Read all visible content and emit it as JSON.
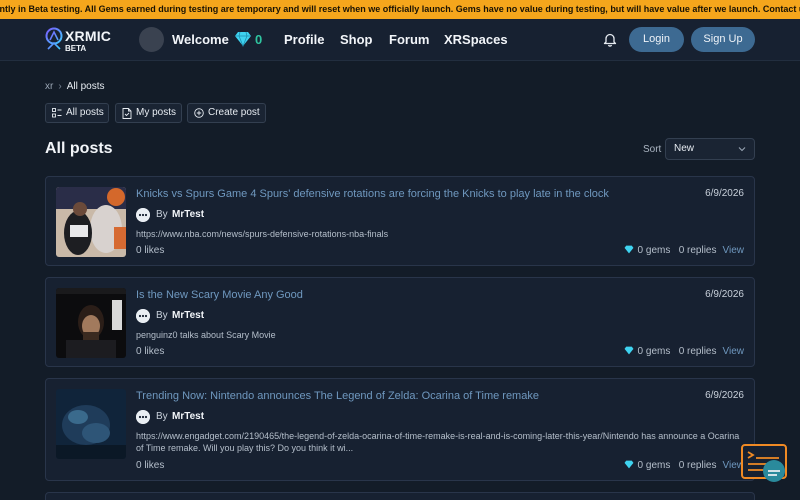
{
  "banner": {
    "text": "rently in Beta testing. All Gems earned during testing are temporary and will reset when we officially launch. Gems have no value during testing, but will have value after we launch. Contact us for any que"
  },
  "header": {
    "logo_text": "XRMIC",
    "logo_sub": "BETA",
    "welcome": "Welcome",
    "gem_count": "0",
    "nav": [
      "Profile",
      "Shop",
      "Forum",
      "XRSpaces"
    ],
    "login_label": "Login",
    "signup_label": "Sign Up"
  },
  "breadcrumb": {
    "root": "xr",
    "current": "All posts"
  },
  "tabs": [
    "All posts",
    "My posts",
    "Create post"
  ],
  "page_title": "All posts",
  "sort": {
    "label": "Sort",
    "value": "New"
  },
  "posts": [
    {
      "title": "Knicks vs Spurs Game 4 Spurs' defensive rotations are forcing the Knicks to play late in the clock",
      "date": "6/9/2026",
      "by": "By",
      "author": "MrTest",
      "description": "https://www.nba.com/news/spurs-defensive-rotations-nba-finals",
      "likes": "0 likes",
      "gems": "0 gems",
      "replies": "0 replies",
      "view": "View"
    },
    {
      "title": "Is the New Scary Movie Any Good",
      "date": "6/9/2026",
      "by": "By",
      "author": "MrTest",
      "description": "penguinz0 talks about Scary Movie",
      "likes": "0 likes",
      "gems": "0 gems",
      "replies": "0 replies",
      "view": "View"
    },
    {
      "title": "Trending Now: Nintendo announces The Legend of Zelda: Ocarina of Time remake",
      "date": "6/9/2026",
      "by": "By",
      "author": "MrTest",
      "description": "https://www.engadget.com/2190465/the-legend-of-zelda-ocarina-of-time-remake-is-real-and-is-coming-later-this-year/Nintendo has announce a Ocarina of Time remake. Will you play this? Do you think it wi...",
      "likes": "0 likes",
      "gems": "0 gems",
      "replies": "0 replies",
      "view": "View"
    }
  ],
  "colors": {
    "banner": "#f5a61c",
    "accent_button": "#3d6a92",
    "gem": "#2fc5a0",
    "link": "#6f98bf"
  },
  "icons": [
    "logo-icon",
    "diamond-icon",
    "bell-icon",
    "chevron-right-icon",
    "list-icon",
    "document-icon",
    "plus-circle-icon",
    "chevron-down-icon",
    "more-dots-icon",
    "chat-bubble-icon"
  ]
}
